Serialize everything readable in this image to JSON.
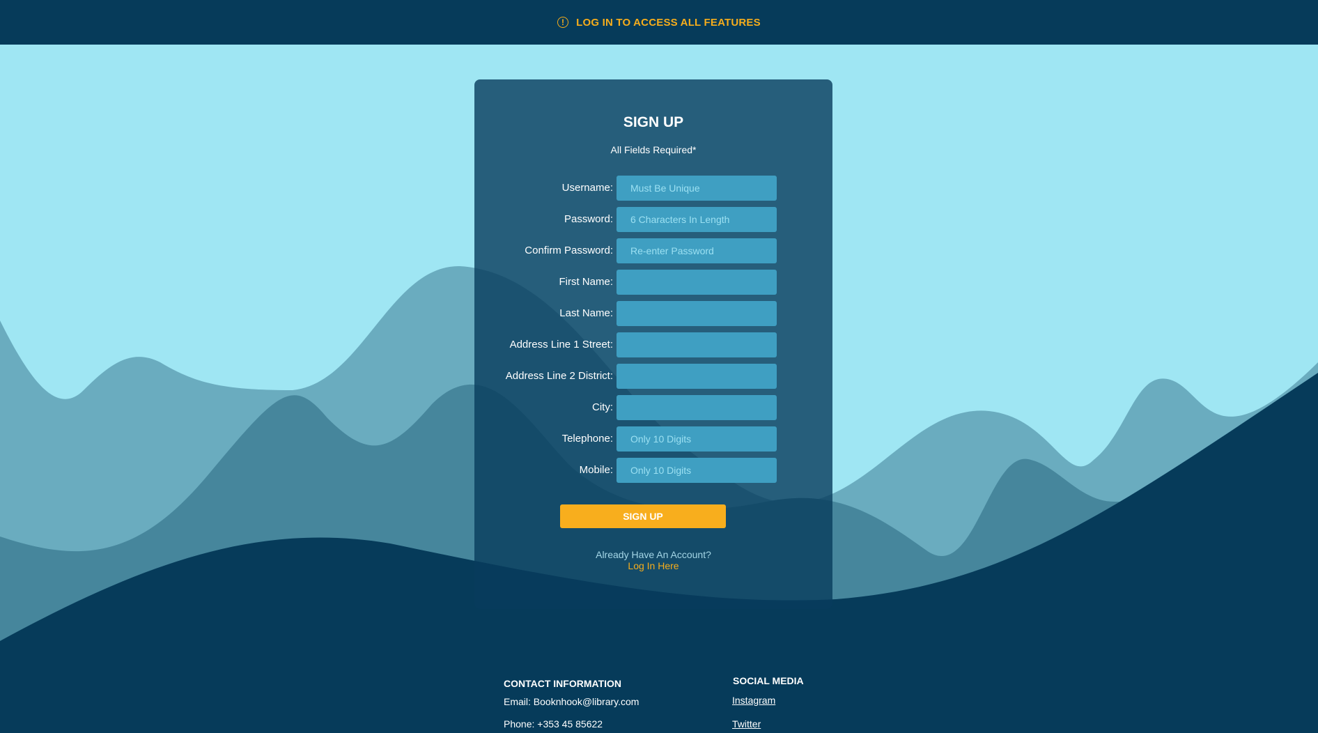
{
  "banner": {
    "icon": "warning-circle-icon",
    "text": "LOG IN TO ACCESS ALL FEATURES"
  },
  "form": {
    "title": "SIGN UP",
    "subtitle": "All Fields Required*",
    "fields": [
      {
        "label": "Username:",
        "placeholder": "Must Be Unique",
        "value": ""
      },
      {
        "label": "Password:",
        "placeholder": "6 Characters In Length",
        "value": ""
      },
      {
        "label": "Confirm Password:",
        "placeholder": "Re-enter Password",
        "value": ""
      },
      {
        "label": "First Name:",
        "placeholder": "",
        "value": ""
      },
      {
        "label": "Last Name:",
        "placeholder": "",
        "value": ""
      },
      {
        "label": "Address Line 1 Street:",
        "placeholder": "",
        "value": ""
      },
      {
        "label": "Address Line 2 District:",
        "placeholder": "",
        "value": ""
      },
      {
        "label": "City:",
        "placeholder": "",
        "value": ""
      },
      {
        "label": "Telephone:",
        "placeholder": "Only 10 Digits",
        "value": ""
      },
      {
        "label": "Mobile:",
        "placeholder": "Only 10 Digits",
        "value": ""
      }
    ],
    "submit_label": "SIGN UP",
    "already_text": "Already Have An Account?",
    "login_link": "Log In Here"
  },
  "footer": {
    "contact_heading": "CONTACT INFORMATION",
    "email_text": "Email:  Booknhook@library.com",
    "phone_text": "Phone: +353 45 85622",
    "social_heading": "SOCIAL MEDIA",
    "social_links": [
      "Instagram",
      "Twitter"
    ]
  },
  "colors": {
    "background": "#9fe6f3",
    "navy": "#063b5a",
    "accent": "#f8ae1d",
    "input": "#3f9fc2"
  }
}
